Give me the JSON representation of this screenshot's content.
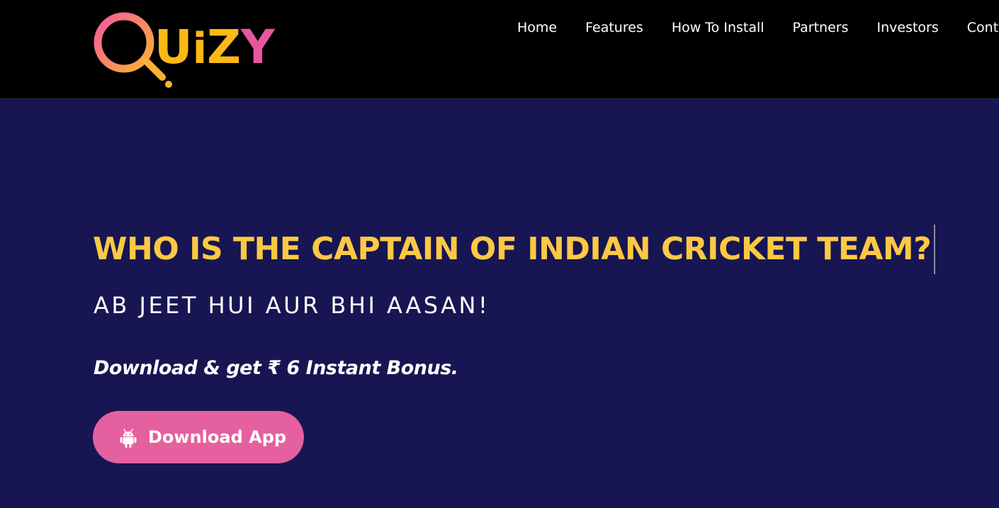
{
  "brand": {
    "logo_text": "QUiZY",
    "colors": {
      "logo_ring_start": "#f45b9b",
      "logo_ring_end": "#fbb233",
      "logo_letter_yellow": "#fbb916",
      "logo_letter_pink": "#e8579d",
      "header_bg": "#000000",
      "hero_bg": "#171652",
      "headline": "#fdc844",
      "button_bg": "#e5609e"
    }
  },
  "nav": {
    "items": [
      {
        "label": "Home"
      },
      {
        "label": "Features"
      },
      {
        "label": "How To Install"
      },
      {
        "label": "Partners"
      },
      {
        "label": "Investors"
      },
      {
        "label": "Contact"
      }
    ]
  },
  "hero": {
    "headline": "WHO IS THE CAPTAIN OF INDIAN CRICKET TEAM?",
    "subheadline": "AB JEET HUI AUR BHI AASAN!",
    "bonus_text": "Download & get ₹ 6 Instant Bonus.",
    "download_button": {
      "label": "Download App",
      "icon": "android-icon"
    }
  }
}
